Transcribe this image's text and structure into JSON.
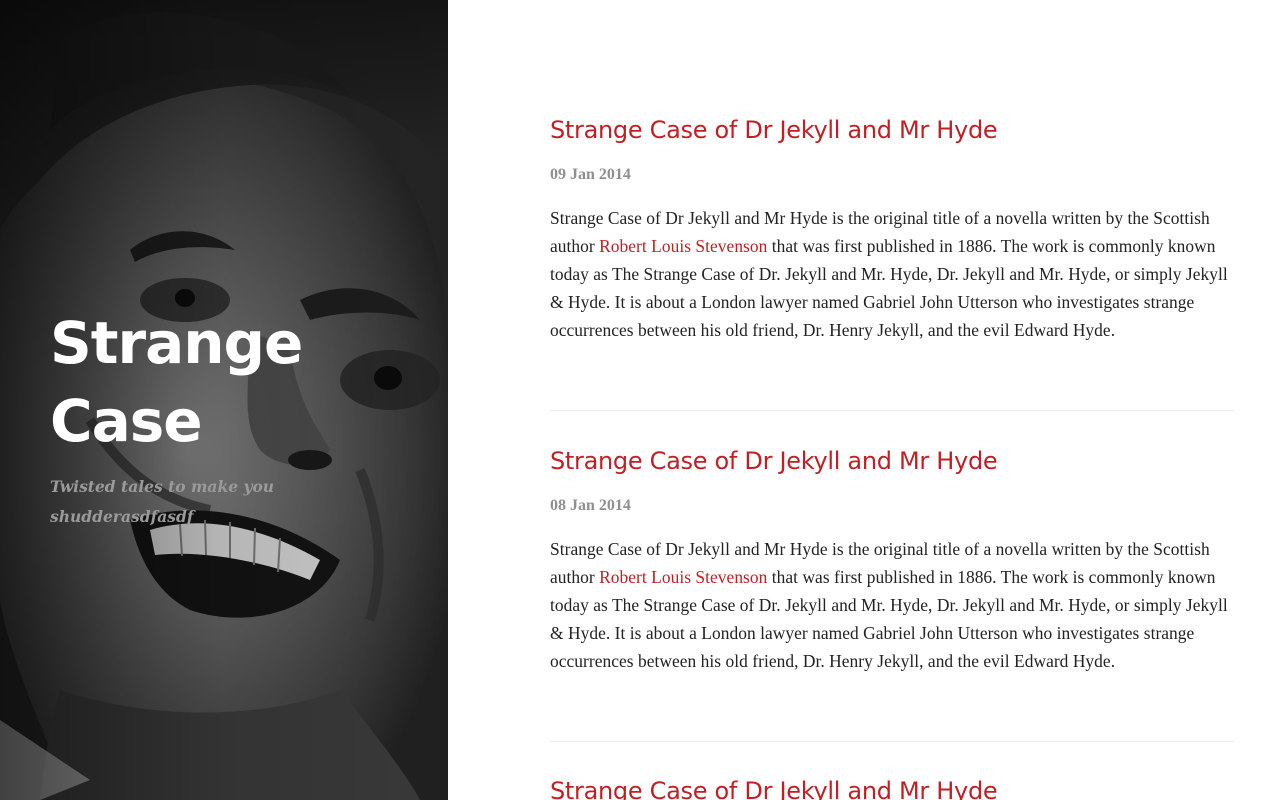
{
  "site": {
    "title": "Strange Case",
    "tagline": "Twisted tales to make you shudderasdfasdf"
  },
  "hero_image": {
    "alt": "black-and-white face"
  },
  "colors": {
    "accent": "#c21f25",
    "date": "#8f8f8f",
    "body_text": "#222222",
    "tagline": "#9a9a9a",
    "divider": "#ebebeb"
  },
  "posts": [
    {
      "title": "Strange Case of Dr Jekyll and Mr Hyde",
      "date": "09 Jan 2014",
      "body_before_link": "Strange Case of Dr Jekyll and Mr Hyde is the original title of a novella written by the Scottish author ",
      "link_text": "Robert Louis Stevenson",
      "body_after_link": " that was first published in 1886. The work is commonly known today as The Strange Case of Dr. Jekyll and Mr. Hyde, Dr. Jekyll and Mr. Hyde, or simply Jekyll & Hyde. It is about a London lawyer named Gabriel John Utterson who investigates strange occurrences between his old friend, Dr. Henry Jekyll, and the evil Edward Hyde."
    },
    {
      "title": "Strange Case of Dr Jekyll and Mr Hyde",
      "date": "08 Jan 2014",
      "body_before_link": "Strange Case of Dr Jekyll and Mr Hyde is the original title of a novella written by the Scottish author ",
      "link_text": "Robert Louis Stevenson",
      "body_after_link": " that was first published in 1886. The work is commonly known today as The Strange Case of Dr. Jekyll and Mr. Hyde, Dr. Jekyll and Mr. Hyde, or simply Jekyll & Hyde. It is about a London lawyer named Gabriel John Utterson who investigates strange occurrences between his old friend, Dr. Henry Jekyll, and the evil Edward Hyde."
    },
    {
      "title": "Strange Case of Dr Jekyll and Mr Hyde"
    }
  ]
}
